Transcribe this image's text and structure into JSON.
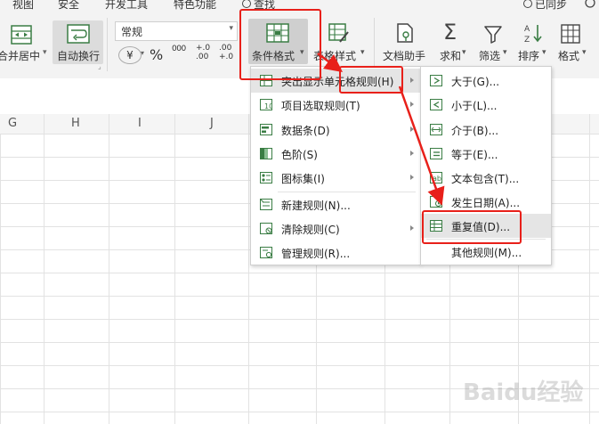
{
  "menu_tabs": [
    "视图",
    "安全",
    "开发工具",
    "特色功能"
  ],
  "search": {
    "label": "查找"
  },
  "sync": {
    "label": "已同步"
  },
  "ribbon": {
    "merge_label": "合并居中",
    "wrap_label": "自动换行",
    "number_format": "常规",
    "currency_symbol": "¥",
    "percent_symbol": "%",
    "thousands_symbol": "000",
    "inc_decimal": "+.0\n.00",
    "dec_decimal": ".00\n+.0",
    "cond_format_label": "条件格式",
    "table_style_label": "表格样式",
    "doc_helper_label": "文档助手",
    "sum_label": "求和",
    "filter_label": "筛选",
    "sort_label": "排序",
    "format_label": "格式"
  },
  "columns": [
    "G",
    "H",
    "I",
    "J"
  ],
  "main_menu": {
    "items": [
      {
        "label": "突出显示单元格规则(H)",
        "submenu": true
      },
      {
        "label": "项目选取规则(T)",
        "submenu": true
      },
      {
        "label": "数据条(D)",
        "submenu": true
      },
      {
        "label": "色阶(S)",
        "submenu": true
      },
      {
        "label": "图标集(I)",
        "submenu": true
      },
      {
        "label": "新建规则(N)...",
        "submenu": false
      },
      {
        "label": "清除规则(C)",
        "submenu": true
      },
      {
        "label": "管理规则(R)...",
        "submenu": false
      }
    ]
  },
  "sub_menu": {
    "items": [
      {
        "label": "大于(G)..."
      },
      {
        "label": "小于(L)..."
      },
      {
        "label": "介于(B)..."
      },
      {
        "label": "等于(E)..."
      },
      {
        "label": "文本包含(T)..."
      },
      {
        "label": "发生日期(A)..."
      },
      {
        "label": "重复值(D)..."
      },
      {
        "label": "其他规则(M)..."
      }
    ]
  },
  "watermark": {
    "text": "Baidu经验"
  },
  "colors": {
    "annotation_red": "#e8201a",
    "menu_highlight": "#e5e5e5",
    "ribbon_bg": "#f3f3f3"
  }
}
